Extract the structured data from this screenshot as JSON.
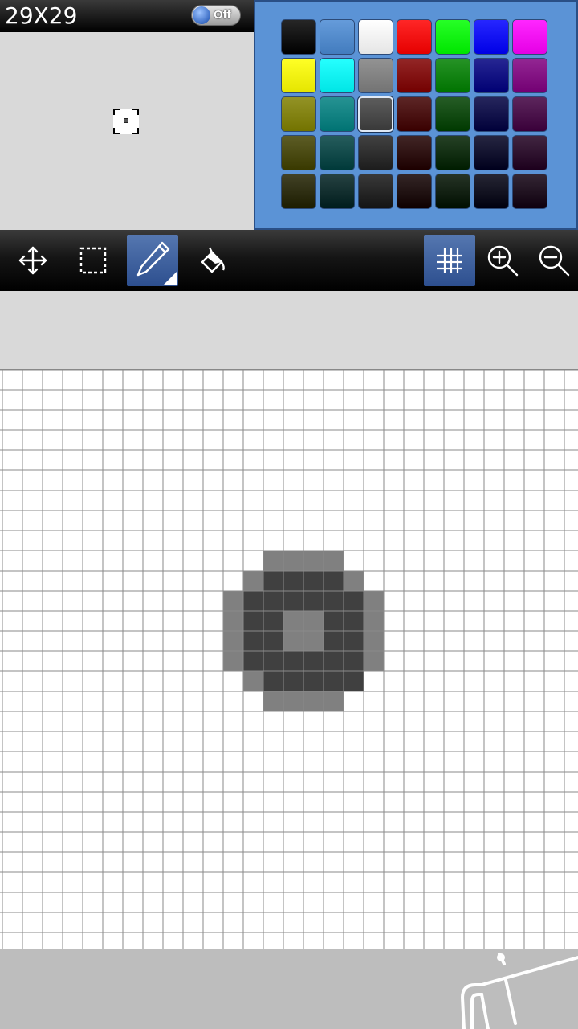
{
  "header": {
    "size_label": "29X29",
    "toggle_label": "Off"
  },
  "palette": {
    "colors": [
      "#000000",
      "#4a8ad4",
      "#ffffff",
      "#ff0000",
      "#00ff00",
      "#0000ff",
      "#ff00ff",
      "#ffff00",
      "#00ffff",
      "#808080",
      "#800000",
      "#008000",
      "#000080",
      "#800080",
      "#808000",
      "#008080",
      "#404040",
      "#400000",
      "#004000",
      "#000040",
      "#400040",
      "#404000",
      "#004040",
      "#202020",
      "#200000",
      "#002000",
      "#000020",
      "#200020",
      "#202000",
      "#002020",
      "#161616",
      "#100000",
      "#001000",
      "#000010",
      "#100010"
    ],
    "selected_index": 16
  },
  "toolbar": {
    "tools": [
      {
        "name": "move-tool-button",
        "icon": "move-arrows-icon",
        "active": false
      },
      {
        "name": "select-tool-button",
        "icon": "marquee-select-icon",
        "active": false
      },
      {
        "name": "pencil-tool-button",
        "icon": "pencil-icon",
        "active": true
      },
      {
        "name": "fill-tool-button",
        "icon": "paint-bucket-icon",
        "active": false
      },
      {
        "name": "grid-toggle-button",
        "icon": "grid-icon",
        "active": true
      },
      {
        "name": "zoom-in-button",
        "icon": "zoom-in-icon",
        "active": false
      },
      {
        "name": "zoom-out-button",
        "icon": "zoom-out-icon",
        "active": false
      }
    ]
  },
  "canvas": {
    "grid_size": 29,
    "colors": {
      "light": "#808080",
      "dark": "#404040"
    },
    "light_pixels": [
      [
        13,
        9
      ],
      [
        14,
        9
      ],
      [
        15,
        9
      ],
      [
        16,
        9
      ],
      [
        12,
        10
      ],
      [
        17,
        10
      ],
      [
        11,
        11
      ],
      [
        18,
        11
      ],
      [
        11,
        12
      ],
      [
        18,
        12
      ],
      [
        11,
        13
      ],
      [
        14,
        12
      ],
      [
        15,
        12
      ],
      [
        14,
        13
      ],
      [
        15,
        13
      ],
      [
        18,
        13
      ],
      [
        11,
        14
      ],
      [
        18,
        14
      ],
      [
        12,
        15
      ],
      [
        13,
        16
      ],
      [
        14,
        16
      ],
      [
        15,
        16
      ],
      [
        16,
        16
      ]
    ],
    "dark_pixels": [
      [
        13,
        10
      ],
      [
        14,
        10
      ],
      [
        15,
        10
      ],
      [
        16,
        10
      ],
      [
        12,
        11
      ],
      [
        13,
        11
      ],
      [
        14,
        11
      ],
      [
        15,
        11
      ],
      [
        16,
        11
      ],
      [
        17,
        11
      ],
      [
        12,
        12
      ],
      [
        13,
        12
      ],
      [
        16,
        12
      ],
      [
        17,
        12
      ],
      [
        12,
        13
      ],
      [
        13,
        13
      ],
      [
        16,
        13
      ],
      [
        17,
        13
      ],
      [
        12,
        14
      ],
      [
        13,
        14
      ],
      [
        14,
        14
      ],
      [
        15,
        14
      ],
      [
        16,
        14
      ],
      [
        17,
        14
      ],
      [
        13,
        15
      ],
      [
        14,
        15
      ],
      [
        15,
        15
      ],
      [
        16,
        15
      ],
      [
        17,
        15
      ]
    ]
  },
  "bottom": {
    "logo_icon": "android-logo-icon"
  }
}
